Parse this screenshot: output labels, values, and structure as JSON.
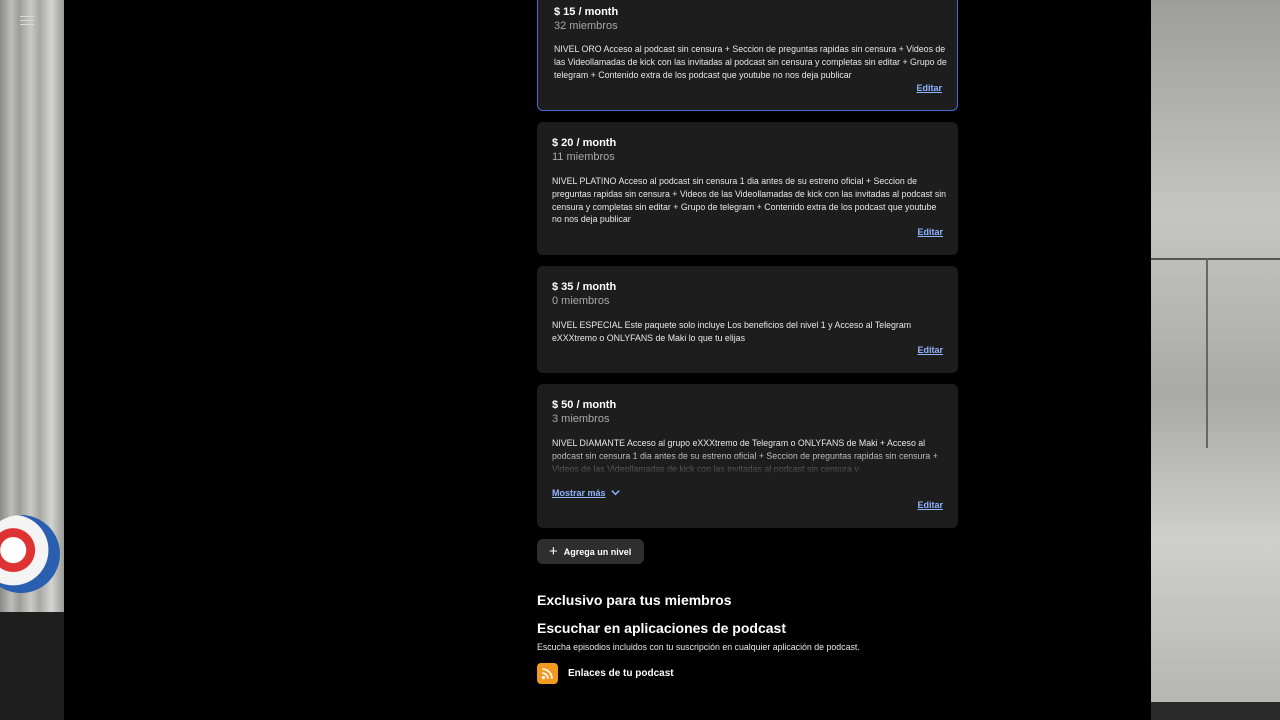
{
  "tiers": [
    {
      "price": "$ 15 / month",
      "members": "32 miembros",
      "description": "NIVEL ORO Acceso al podcast sin censura + Seccion de preguntas rapidas sin censura + Videos de las Videollamadas de kick con las invitadas al podcast sin censura y completas sin editar + Grupo de telegram + Contenido extra de los podcast que youtube no nos deja publicar",
      "edit_label": "Editar"
    },
    {
      "price": "$ 20 / month",
      "members": "11 miembros",
      "description": "NIVEL PLATINO Acceso al podcast sin censura 1 dia antes de su estreno oficial + Seccion de preguntas rapidas sin censura + Videos de las Videollamadas de kick con las invitadas al podcast sin censura y completas sin editar + Grupo de telegram + Contenido extra de los podcast que youtube no nos deja publicar",
      "edit_label": "Editar"
    },
    {
      "price": "$ 35 / month",
      "members": "0 miembros",
      "description": "NIVEL ESPECIAL Este paquete solo incluye Los beneficios del nivel 1 y Acceso al Telegram eXXXtremo o ONLYFANS de Maki lo que tu elijas",
      "edit_label": "Editar"
    },
    {
      "price": "$ 50 / month",
      "members": "3 miembros",
      "description": "NIVEL DIAMANTE Acceso al grupo eXXXtremo de Telegram o ONLYFANS de Maki + Acceso al podcast sin censura 1 dia antes de su estreno oficial + Seccion de preguntas rapidas sin censura + Videos de las Videollamadas de kick con las invitadas al podcast sin censura y",
      "show_more_label": "Mostrar más",
      "edit_label": "Editar"
    }
  ],
  "add_level_label": "Agrega un nivel",
  "exclusive_heading": "Exclusivo para tus miembros",
  "listen_heading": "Escuchar en aplicaciones de podcast",
  "listen_subtext": "Escucha episodios incluidos con tu suscripción en cualquier aplicación de podcast.",
  "podcast_links_label": "Enlaces de tu podcast",
  "colors": {
    "accent_link": "#8fb4ff",
    "selected_border": "#3b6fd6",
    "rss_orange": "#f29a1f",
    "card_bg": "#1d1d1d"
  },
  "icons": {
    "menu": "hamburger-menu-icon",
    "add": "plus-icon",
    "show_more": "chevron-down-icon",
    "podcast_links": "rss-icon"
  }
}
